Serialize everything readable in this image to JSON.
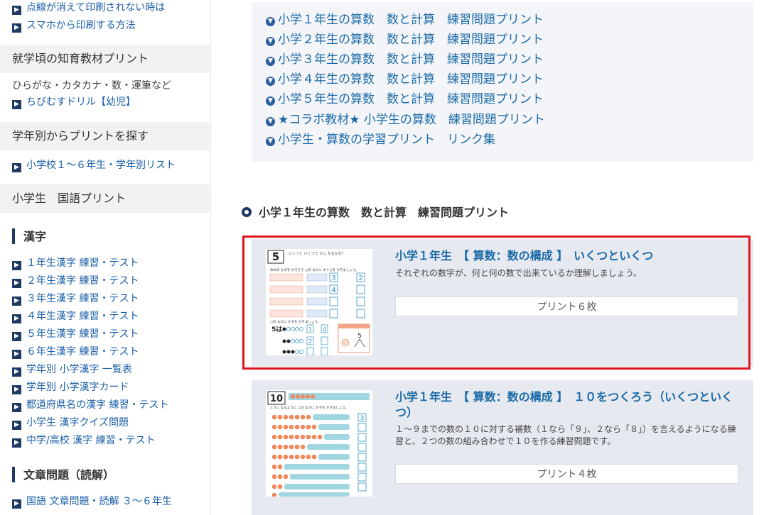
{
  "sidebar": {
    "top_links": [
      "点線が消えて印刷されない時は",
      "スマホから印刷する方法"
    ],
    "chiiku": {
      "heading": "就学頃の知育教材プリント",
      "text": "ひらがな・カタカナ・数・運筆など",
      "link": "ちびむすドリル【幼児】"
    },
    "grade": {
      "heading": "学年別からプリントを探す",
      "link": "小学校１～６年生・学年別リスト"
    },
    "kokugo": {
      "heading": "小学生　国語プリント",
      "kanji_title": "漢字",
      "kanji_links": [
        "１年生漢字 練習・テスト",
        "２年生漢字 練習・テスト",
        "３年生漢字 練習・テスト",
        "４年生漢字 練習・テスト",
        "５年生漢字 練習・テスト",
        "６年生漢字 練習・テスト",
        "学年別 小学漢字 一覧表",
        "学年別 小学漢字カード",
        "都道府県名の漢字 練習・テスト",
        "小学生 漢字クイズ問題",
        "中学/高校 漢字 練習・テスト"
      ],
      "reading_title": "文章問題（読解）",
      "reading_links": [
        "国語 文章問題・読解 ３～６年生"
      ]
    }
  },
  "toc": {
    "items": [
      "小学１年生の算数　数と計算　練習問題プリント",
      "小学２年生の算数　数と計算　練習問題プリント",
      "小学３年生の算数　数と計算　練習問題プリント",
      "小学４年生の算数　数と計算　練習問題プリント",
      "小学５年生の算数　数と計算　練習問題プリント",
      "★コラボ教材★ 小学生の算数　練習問題プリント",
      "小学生・算数の学習プリント　リンク集"
    ]
  },
  "section": {
    "heading": "小学１年生の算数　数と計算　練習問題プリント"
  },
  "cards": [
    {
      "title": "小学１年生　【 算数：数の構成 】　いくつといくつ",
      "desc": "それぞれの数字が、何と何の数で出来ているか理解しましょう。",
      "button": "プリント６枚",
      "thumb": {
        "big_number": "5",
        "header": "いくつと いくつで ５に なるかな？",
        "q1": "あめの かずを かぞえて □の なかに すうじを かきましょう。",
        "nums": [
          "3",
          "2",
          "4"
        ],
        "q2": "□の なかに かずを かきましょう。",
        "row5": "5は",
        "answers": [
          "1",
          "4",
          "2"
        ],
        "side_num": "5"
      }
    },
    {
      "title": "小学１年生　【 算数：数の構成 】　１０をつくろう（いくつといくつ）",
      "desc": "１～９までの数の１０に対する補数（１なら「９」、２なら「８」）を言えるようになる練習と、２つの数の組み合わせで１０を作る練習問題です。",
      "button": "プリント４枚",
      "thumb": {
        "big_number": "10",
        "q1": "１０に なるように □の なかに かずを かきましょう。",
        "nums": [
          "3"
        ]
      }
    }
  ],
  "colors": {
    "link": "#1a6aa8",
    "navy": "#1f3a63",
    "highlight": "#e0141e",
    "card_bg": "#e6e9ef"
  }
}
